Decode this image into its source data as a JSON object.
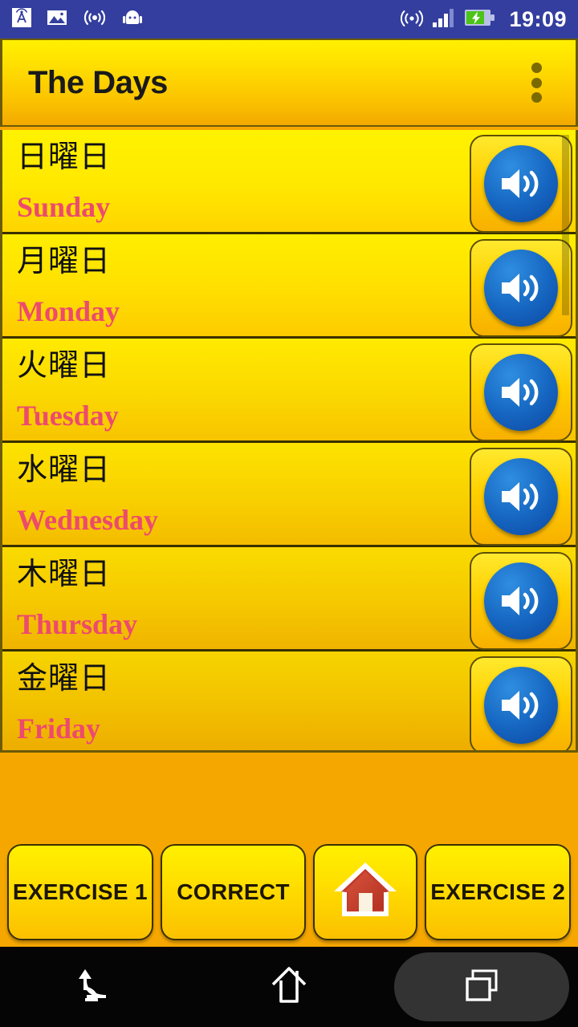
{
  "status_bar": {
    "time": "19:09",
    "left_icons": [
      {
        "name": "cast-tower-icon",
        "label": "cast"
      },
      {
        "name": "picture-icon",
        "label": "screenshot"
      },
      {
        "name": "wireless-waves-icon",
        "label": "nfc"
      },
      {
        "name": "android-robot-icon",
        "label": "android"
      }
    ],
    "right_icons": [
      {
        "name": "wifi-icon",
        "label": "wifi"
      },
      {
        "name": "signal-bars-icon",
        "label": "signal",
        "bars_total": 4,
        "bars_filled": 3
      },
      {
        "name": "battery-charging-icon",
        "label": "battery charging"
      }
    ],
    "background_color": "#333E9E"
  },
  "title_bar": {
    "title": "The Days",
    "overflow_menu_name": "overflow-menu-icon",
    "accent_start": "#FFF000",
    "accent_end": "#F2A900"
  },
  "list": {
    "speaker_icon_name": "speaker-icon",
    "scrollbar_visible": true,
    "rows": [
      {
        "japanese": "日曜日",
        "english": "Sunday"
      },
      {
        "japanese": "月曜日",
        "english": "Monday"
      },
      {
        "japanese": "火曜日",
        "english": "Tuesday"
      },
      {
        "japanese": "水曜日",
        "english": "Wednesday"
      },
      {
        "japanese": "木曜日",
        "english": "Thursday"
      },
      {
        "japanese": "金曜日",
        "english": "Friday"
      }
    ],
    "english_color": "#ED4A6E",
    "japanese_color": "#111111"
  },
  "bottom_buttons": [
    {
      "label": "EXERCISE 1",
      "name": "exercise-1-button"
    },
    {
      "label": "CORRECT",
      "name": "correct-button"
    },
    {
      "label": "",
      "name": "home-button",
      "icon": "house-icon"
    },
    {
      "label": "EXERCISE 2",
      "name": "exercise-2-button"
    }
  ],
  "nav_bar": {
    "back": "back-icon",
    "home": "home-icon",
    "recents": "recents-icon",
    "background_color": "#050505"
  }
}
